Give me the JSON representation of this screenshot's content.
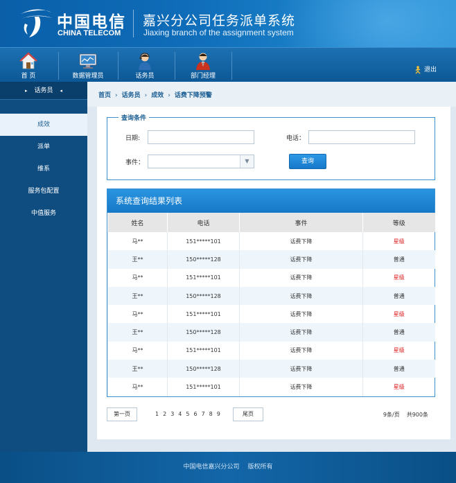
{
  "header": {
    "logo_cn": "中国电信",
    "logo_en": "CHINA TELECOM",
    "system_title": "嘉兴分公司任务派单系统",
    "system_subtitle": "Jiaxing branch of the assignment system"
  },
  "nav": {
    "items": [
      {
        "label": "首 页",
        "icon": "home-icon"
      },
      {
        "label": "数据管理员",
        "icon": "monitor-icon"
      },
      {
        "label": "话务员",
        "icon": "operator-icon"
      },
      {
        "label": "部门经理",
        "icon": "manager-icon"
      }
    ],
    "logout_label": "退出"
  },
  "sidebar": {
    "header": "话务员",
    "items": [
      {
        "label": "成效"
      },
      {
        "label": "派单"
      },
      {
        "label": "维系"
      },
      {
        "label": "服务包配置"
      },
      {
        "label": "中值服务"
      }
    ]
  },
  "breadcrumb": [
    "首页",
    "话务员",
    "成效",
    "话费下降预警"
  ],
  "query": {
    "legend": "查询条件",
    "date_label": "日期:",
    "phone_label": "电话：",
    "event_label": "事件：",
    "date_value": "",
    "phone_value": "",
    "event_value": "",
    "search_label": "查询"
  },
  "results": {
    "title": "系统查询结果列表",
    "columns": [
      "姓名",
      "电话",
      "事件",
      "等级"
    ],
    "rows": [
      {
        "name": "马**",
        "phone": "151*****101",
        "event": "话费下降",
        "level": "星级"
      },
      {
        "name": "王**",
        "phone": "150*****128",
        "event": "话费下降",
        "level": "普通"
      },
      {
        "name": "马**",
        "phone": "151*****101",
        "event": "话费下降",
        "level": "星级"
      },
      {
        "name": "王**",
        "phone": "150*****128",
        "event": "话费下降",
        "level": "普通"
      },
      {
        "name": "马**",
        "phone": "151*****101",
        "event": "话费下降",
        "level": "星级"
      },
      {
        "name": "王**",
        "phone": "150*****128",
        "event": "话费下降",
        "level": "普通"
      },
      {
        "name": "马**",
        "phone": "151*****101",
        "event": "话费下降",
        "level": "星级"
      },
      {
        "name": "王**",
        "phone": "150*****128",
        "event": "话费下降",
        "level": "普通"
      },
      {
        "name": "马**",
        "phone": "151*****101",
        "event": "话费下降",
        "level": "星级"
      }
    ]
  },
  "pager": {
    "first_label": "第一页",
    "last_label": "尾页",
    "pages": [
      "1",
      "2",
      "3",
      "4",
      "5",
      "6",
      "7",
      "8",
      "9"
    ],
    "per_page": "9条/页",
    "total": "共900条"
  },
  "footer": {
    "company": "中国电信嘉兴分公司",
    "rights": "版权所有"
  },
  "colors": {
    "brand_blue": "#1679c8",
    "star_red": "#e02020",
    "sidebar_bg": "#0f4d80"
  }
}
